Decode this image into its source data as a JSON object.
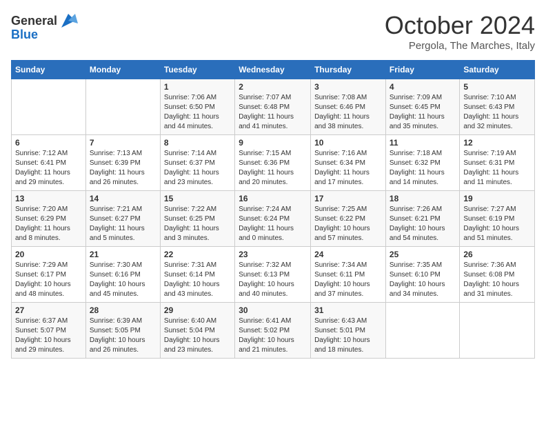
{
  "header": {
    "logo_general": "General",
    "logo_blue": "Blue",
    "month": "October 2024",
    "location": "Pergola, The Marches, Italy"
  },
  "days_of_week": [
    "Sunday",
    "Monday",
    "Tuesday",
    "Wednesday",
    "Thursday",
    "Friday",
    "Saturday"
  ],
  "weeks": [
    [
      {
        "day": "",
        "info": ""
      },
      {
        "day": "",
        "info": ""
      },
      {
        "day": "1",
        "info": "Sunrise: 7:06 AM\nSunset: 6:50 PM\nDaylight: 11 hours and 44 minutes."
      },
      {
        "day": "2",
        "info": "Sunrise: 7:07 AM\nSunset: 6:48 PM\nDaylight: 11 hours and 41 minutes."
      },
      {
        "day": "3",
        "info": "Sunrise: 7:08 AM\nSunset: 6:46 PM\nDaylight: 11 hours and 38 minutes."
      },
      {
        "day": "4",
        "info": "Sunrise: 7:09 AM\nSunset: 6:45 PM\nDaylight: 11 hours and 35 minutes."
      },
      {
        "day": "5",
        "info": "Sunrise: 7:10 AM\nSunset: 6:43 PM\nDaylight: 11 hours and 32 minutes."
      }
    ],
    [
      {
        "day": "6",
        "info": "Sunrise: 7:12 AM\nSunset: 6:41 PM\nDaylight: 11 hours and 29 minutes."
      },
      {
        "day": "7",
        "info": "Sunrise: 7:13 AM\nSunset: 6:39 PM\nDaylight: 11 hours and 26 minutes."
      },
      {
        "day": "8",
        "info": "Sunrise: 7:14 AM\nSunset: 6:37 PM\nDaylight: 11 hours and 23 minutes."
      },
      {
        "day": "9",
        "info": "Sunrise: 7:15 AM\nSunset: 6:36 PM\nDaylight: 11 hours and 20 minutes."
      },
      {
        "day": "10",
        "info": "Sunrise: 7:16 AM\nSunset: 6:34 PM\nDaylight: 11 hours and 17 minutes."
      },
      {
        "day": "11",
        "info": "Sunrise: 7:18 AM\nSunset: 6:32 PM\nDaylight: 11 hours and 14 minutes."
      },
      {
        "day": "12",
        "info": "Sunrise: 7:19 AM\nSunset: 6:31 PM\nDaylight: 11 hours and 11 minutes."
      }
    ],
    [
      {
        "day": "13",
        "info": "Sunrise: 7:20 AM\nSunset: 6:29 PM\nDaylight: 11 hours and 8 minutes."
      },
      {
        "day": "14",
        "info": "Sunrise: 7:21 AM\nSunset: 6:27 PM\nDaylight: 11 hours and 5 minutes."
      },
      {
        "day": "15",
        "info": "Sunrise: 7:22 AM\nSunset: 6:25 PM\nDaylight: 11 hours and 3 minutes."
      },
      {
        "day": "16",
        "info": "Sunrise: 7:24 AM\nSunset: 6:24 PM\nDaylight: 11 hours and 0 minutes."
      },
      {
        "day": "17",
        "info": "Sunrise: 7:25 AM\nSunset: 6:22 PM\nDaylight: 10 hours and 57 minutes."
      },
      {
        "day": "18",
        "info": "Sunrise: 7:26 AM\nSunset: 6:21 PM\nDaylight: 10 hours and 54 minutes."
      },
      {
        "day": "19",
        "info": "Sunrise: 7:27 AM\nSunset: 6:19 PM\nDaylight: 10 hours and 51 minutes."
      }
    ],
    [
      {
        "day": "20",
        "info": "Sunrise: 7:29 AM\nSunset: 6:17 PM\nDaylight: 10 hours and 48 minutes."
      },
      {
        "day": "21",
        "info": "Sunrise: 7:30 AM\nSunset: 6:16 PM\nDaylight: 10 hours and 45 minutes."
      },
      {
        "day": "22",
        "info": "Sunrise: 7:31 AM\nSunset: 6:14 PM\nDaylight: 10 hours and 43 minutes."
      },
      {
        "day": "23",
        "info": "Sunrise: 7:32 AM\nSunset: 6:13 PM\nDaylight: 10 hours and 40 minutes."
      },
      {
        "day": "24",
        "info": "Sunrise: 7:34 AM\nSunset: 6:11 PM\nDaylight: 10 hours and 37 minutes."
      },
      {
        "day": "25",
        "info": "Sunrise: 7:35 AM\nSunset: 6:10 PM\nDaylight: 10 hours and 34 minutes."
      },
      {
        "day": "26",
        "info": "Sunrise: 7:36 AM\nSunset: 6:08 PM\nDaylight: 10 hours and 31 minutes."
      }
    ],
    [
      {
        "day": "27",
        "info": "Sunrise: 6:37 AM\nSunset: 5:07 PM\nDaylight: 10 hours and 29 minutes."
      },
      {
        "day": "28",
        "info": "Sunrise: 6:39 AM\nSunset: 5:05 PM\nDaylight: 10 hours and 26 minutes."
      },
      {
        "day": "29",
        "info": "Sunrise: 6:40 AM\nSunset: 5:04 PM\nDaylight: 10 hours and 23 minutes."
      },
      {
        "day": "30",
        "info": "Sunrise: 6:41 AM\nSunset: 5:02 PM\nDaylight: 10 hours and 21 minutes."
      },
      {
        "day": "31",
        "info": "Sunrise: 6:43 AM\nSunset: 5:01 PM\nDaylight: 10 hours and 18 minutes."
      },
      {
        "day": "",
        "info": ""
      },
      {
        "day": "",
        "info": ""
      }
    ]
  ]
}
